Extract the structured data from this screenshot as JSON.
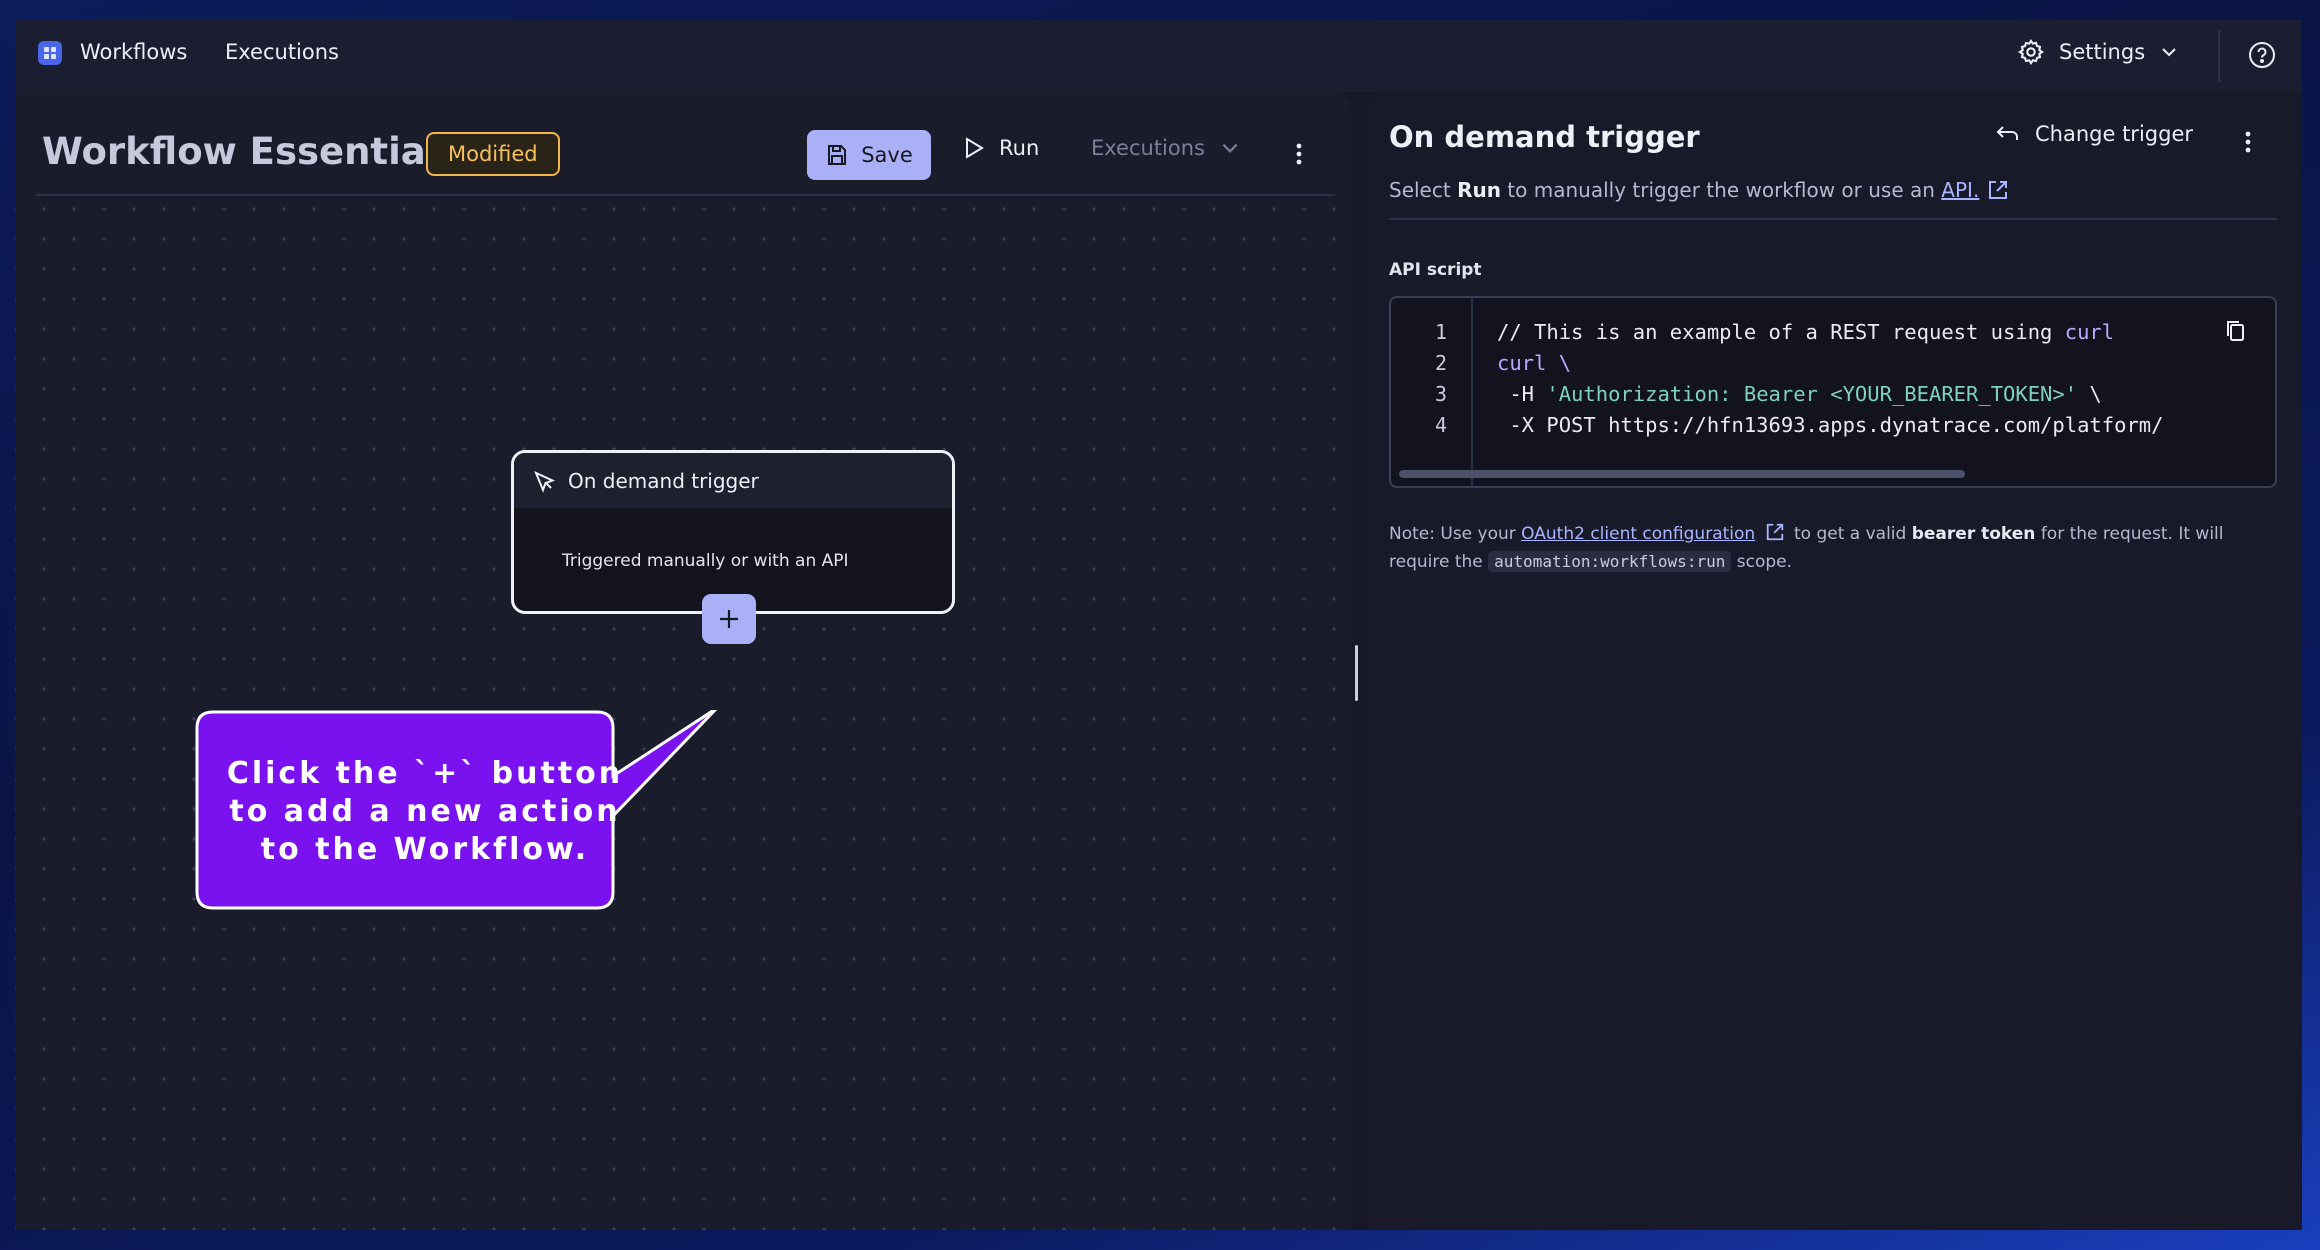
{
  "topbar": {
    "nav": [
      "Workflows",
      "Executions"
    ],
    "settings_label": "Settings",
    "icons": [
      "app-logo-icon",
      "gear-icon",
      "chevron-down-icon",
      "help-icon"
    ]
  },
  "workflow": {
    "title": "Workflow Essentials",
    "status_badge": "Modified",
    "save_label": "Save",
    "run_label": "Run",
    "executions_label": "Executions"
  },
  "node": {
    "title": "On demand trigger",
    "description": "Triggered manually or with an API"
  },
  "callout": {
    "lines": [
      "Click the `+` button",
      "to add a new action",
      "to the Workflow."
    ],
    "color": "#7a12f0"
  },
  "panel": {
    "title": "On demand trigger",
    "change_trigger_label": "Change trigger",
    "subtitle_prefix": "Select ",
    "subtitle_bold": "Run",
    "subtitle_middle": " to manually trigger the workflow or use an ",
    "subtitle_link": "API.",
    "api_script_label": "API script",
    "code": {
      "line_numbers": [
        "1",
        "2",
        "3",
        "4"
      ],
      "lines": [
        "// This is an example of a REST request using ",
        "curl \\",
        " -H ",
        " -X POST https://hfn13693.apps.dynatrace.com/platform/"
      ],
      "line1_kw": "curl",
      "line3_str": "'Authorization: Bearer <YOUR_BEARER_TOKEN>'",
      "line3_tail": " \\"
    },
    "note": {
      "prefix": "Note: Use your ",
      "link": "OAuth2 client configuration",
      "middle": " to get a valid ",
      "bold": "bearer token",
      "after_bold": " for the request. It will require the ",
      "scope_code": "automation:workflows:run",
      "suffix": " scope."
    }
  },
  "colors": {
    "accent": "#a9b0f5",
    "badge": "#f2b54a",
    "link": "#a8b5ff"
  }
}
